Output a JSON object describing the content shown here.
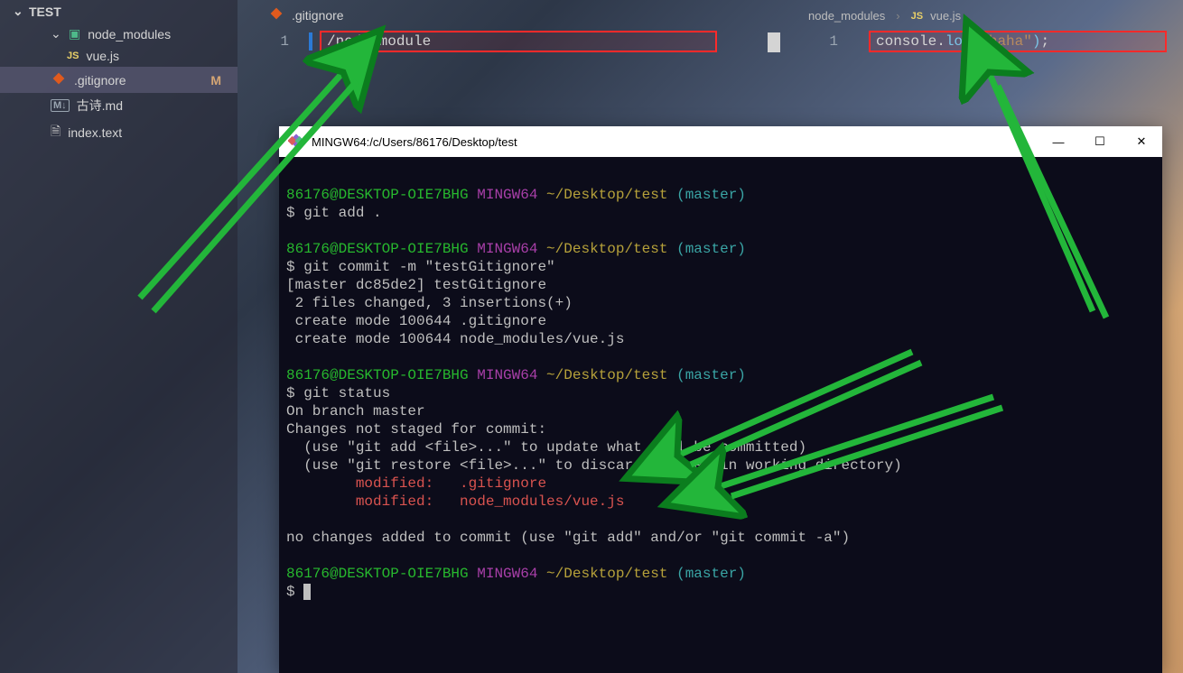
{
  "explorer": {
    "root": "TEST",
    "folder": "node_modules",
    "vue": "vue.js",
    "gitignore": ".gitignore",
    "gitignore_status": "M",
    "poem": "古诗.md",
    "index": "index.text",
    "js_badge": "JS",
    "md_badge": "M↓"
  },
  "tab_left": {
    "label": ".gitignore"
  },
  "breadcrumb": {
    "folder": "node_modules",
    "sep": "›",
    "js_badge": "JS",
    "file": "vue.js"
  },
  "editor_left": {
    "lineno": "1",
    "content": "/node_module"
  },
  "editor_right": {
    "lineno": "1",
    "obj": "console",
    "dot": ".",
    "fn": "log",
    "open": "(",
    "str": "\"haha\"",
    "close": ")",
    "semi": ";"
  },
  "terminal": {
    "title": "MINGW64:/c/Users/86176/Desktop/test",
    "lines": {
      "p1_user": "86176@DESKTOP-OIE7BHG",
      "p1_sys": " MINGW64",
      "p1_path": " ~/Desktop/test",
      "p1_branch": " (master)",
      "cmd1": "$ git add .",
      "cmd2": "$ git commit -m \"testGitignore\"",
      "out1": "[master dc85de2] testGitignore",
      "out2": " 2 files changed, 3 insertions(+)",
      "out3": " create mode 100644 .gitignore",
      "out4": " create mode 100644 node_modules/vue.js",
      "cmd3": "$ git status",
      "st1": "On branch master",
      "st2": "Changes not staged for commit:",
      "st3": "  (use \"git add <file>...\" to update what will be committed)",
      "st4": "  (use \"git restore <file>...\" to discard changes in working directory)",
      "mod1": "        modified:   .gitignore",
      "mod2": "        modified:   node_modules/vue.js",
      "st5": "no changes added to commit (use \"git add\" and/or \"git commit -a\")",
      "prompt_dollar": "$ "
    }
  },
  "win": {
    "min": "—",
    "max": "☐",
    "close": "✕"
  }
}
